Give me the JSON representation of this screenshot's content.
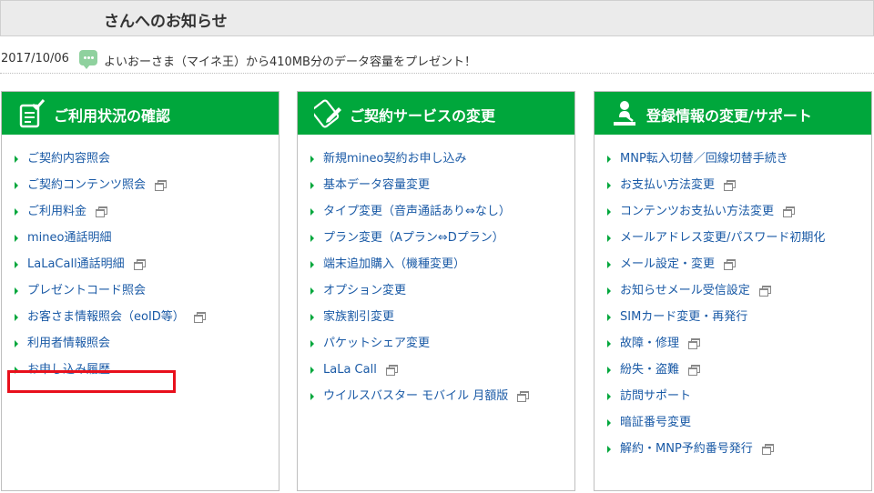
{
  "notice": {
    "title": "さんへのお知らせ",
    "date": "2017/10/06",
    "message": "よいおーさま（マイネ王）から410MB分のデータ容量をプレゼント！"
  },
  "panels": [
    {
      "title": "ご利用状況の確認",
      "icon": "clipboard-check-icon",
      "links": [
        {
          "label": "ご契約内容照会",
          "external": false
        },
        {
          "label": "ご契約コンテンツ照会",
          "external": true
        },
        {
          "label": "ご利用料金",
          "external": true
        },
        {
          "label": "mineo通話明細",
          "external": false
        },
        {
          "label": "LaLaCall通話明細",
          "external": true
        },
        {
          "label": "プレゼントコード照会",
          "external": false
        },
        {
          "label": "お客さま情報照会（eoID等）",
          "external": true
        },
        {
          "label": "利用者情報照会",
          "external": false
        },
        {
          "label": "お申し込み履歴",
          "external": false
        }
      ]
    },
    {
      "title": "ご契約サービスの変更",
      "icon": "pencil-edit-icon",
      "links": [
        {
          "label": "新規mineo契約お申し込み",
          "external": false
        },
        {
          "label": "基本データ容量変更",
          "external": false
        },
        {
          "label": "タイプ変更（音声通話あり⇔なし）",
          "external": false
        },
        {
          "label": "プラン変更（Aプラン⇔Dプラン）",
          "external": false
        },
        {
          "label": "端末追加購入（機種変更）",
          "external": false
        },
        {
          "label": "オプション変更",
          "external": false
        },
        {
          "label": "家族割引変更",
          "external": false
        },
        {
          "label": "パケットシェア変更",
          "external": false
        },
        {
          "label": "LaLa Call",
          "external": true
        },
        {
          "label": "ウイルスバスター モバイル 月額版",
          "external": true
        }
      ]
    },
    {
      "title": "登録情報の変更/サポート",
      "icon": "support-person-icon",
      "links": [
        {
          "label": "MNP転入切替／回線切替手続き",
          "external": false
        },
        {
          "label": "お支払い方法変更",
          "external": true
        },
        {
          "label": "コンテンツお支払い方法変更",
          "external": true
        },
        {
          "label": "メールアドレス変更/パスワード初期化",
          "external": false
        },
        {
          "label": "メール設定・変更",
          "external": true
        },
        {
          "label": "お知らせメール受信設定",
          "external": true
        },
        {
          "label": "SIMカード変更・再発行",
          "external": false
        },
        {
          "label": "故障・修理",
          "external": true
        },
        {
          "label": "紛失・盗難",
          "external": true
        },
        {
          "label": "訪問サポート",
          "external": false
        },
        {
          "label": "暗証番号変更",
          "external": false
        },
        {
          "label": "解約・MNP予約番号発行",
          "external": true
        }
      ]
    }
  ],
  "colors": {
    "accent_green": "#00a73c",
    "link_blue": "#1a5aa6",
    "highlight_red": "#e8101c"
  }
}
